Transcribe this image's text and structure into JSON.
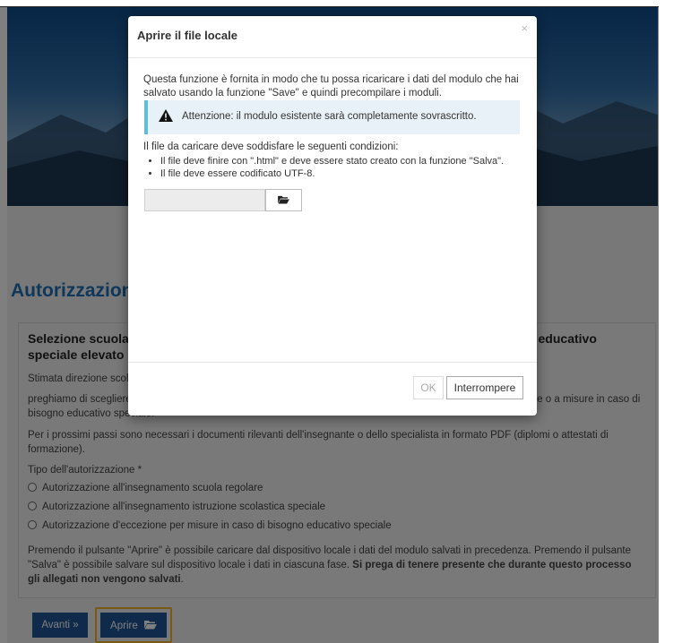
{
  "page": {
    "title": "Autorizzazione",
    "panel_heading": "Selezione scuola regolare, istruzione scolastica speciale o misure in caso di bisogno educativo speciale elevato",
    "intro": "Stimata direzione scolastica,",
    "instruction": "preghiamo di scegliere il tipo di autorizzazione all'insegnamento scuola regolare, all'istruzione scolastica speciale o a misure in caso di bisogno educativo speciale.",
    "documents_note": "Per i prossimi passi sono necessari i documenti rilevanti dell'insegnante o dello specialista in formato PDF (diplomi o attestati di formazione).",
    "auth_type_label": "Tipo dell'autorizzazione *",
    "auth_options": [
      "Autorizzazione all'insegnamento scuola regolare",
      "Autorizzazione all'insegnamento istruzione scolastica speciale",
      "Autorizzazione d'eccezione per misure in caso di bisogno educativo speciale"
    ],
    "footer_note_1": "Premendo il pulsante \"Aprire\" è possibile caricare dal dispositivo locale i dati del modulo salvati in precedenza. Premendo il pulsante \"Salva\" è possibile salvare sul dispositivo locale i dati in ciascuna fase. ",
    "footer_note_bold": "Si prega di tenere presente che durante questo processo gli allegati non vengono salvati",
    "footer_note_end": ".",
    "next_button": "Avanti",
    "next_icon": "»",
    "open_button": "Aprire",
    "open_icon": "folder-open-icon"
  },
  "modal": {
    "title": "Aprire il file locale",
    "close_icon": "×",
    "description": "Questa funzione è fornita in modo che tu possa ricaricare i dati del modulo che hai salvato usando la funzione \"Save\" e quindi precompilare i moduli.",
    "warning": "Attenzione: il modulo esistente sarà completamente sovrascritto.",
    "conditions_title": "Il file da caricare deve soddisfare le seguenti condizioni:",
    "conditions": [
      "Il file deve finire con \".html\" e deve essere stato creato con la funzione \"Salva\".",
      "Il file deve essere codificato UTF-8."
    ],
    "browse_icon": "folder-open-icon",
    "ok_button": "OK",
    "cancel_button": "Interrompere"
  },
  "colors": {
    "title_blue": "#1f6fb4",
    "button_blue": "#1f5596",
    "highlight": "#f0b429",
    "info_border": "#5bc0de"
  }
}
